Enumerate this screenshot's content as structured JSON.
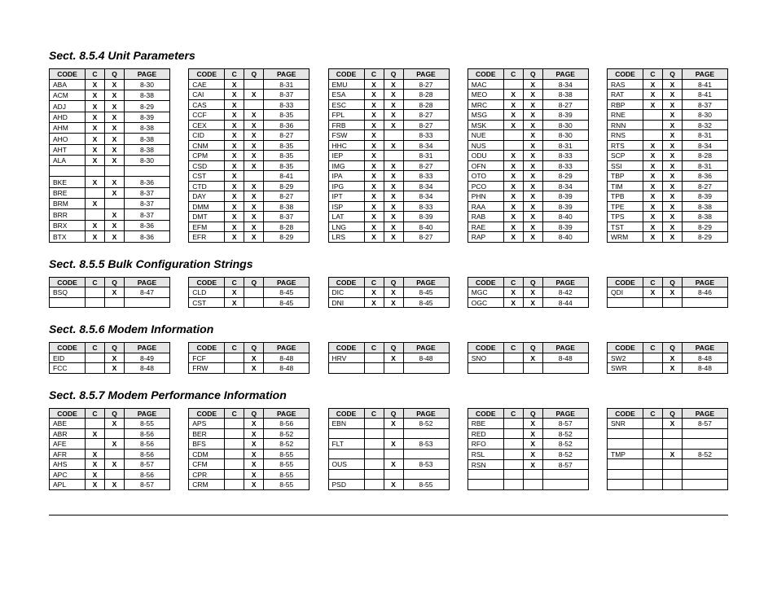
{
  "headers": {
    "code": "CODE",
    "c": "C",
    "q": "Q",
    "page": "PAGE"
  },
  "sections": [
    {
      "title": "Sect. 8.5.4 Unit Parameters",
      "tables": [
        [
          {
            "code": "ABA",
            "c": "X",
            "q": "X",
            "page": "8-30"
          },
          {
            "code": "ACM",
            "c": "X",
            "q": "X",
            "page": "8-38"
          },
          {
            "code": "ADJ",
            "c": "X",
            "q": "X",
            "page": "8-29"
          },
          {
            "code": "AHD",
            "c": "X",
            "q": "X",
            "page": "8-39"
          },
          {
            "code": "AHM",
            "c": "X",
            "q": "X",
            "page": "8-38"
          },
          {
            "code": "AHO",
            "c": "X",
            "q": "X",
            "page": "8-38"
          },
          {
            "code": "AHT",
            "c": "X",
            "q": "X",
            "page": "8-38"
          },
          {
            "code": "ALA",
            "c": "X",
            "q": "X",
            "page": "8-30"
          },
          {
            "code": "",
            "c": "",
            "q": "",
            "page": ""
          },
          {
            "code": "BKE",
            "c": "X",
            "q": "X",
            "page": "8-36"
          },
          {
            "code": "BRE",
            "c": "",
            "q": "X",
            "page": "8-37"
          },
          {
            "code": "BRM",
            "c": "X",
            "q": "",
            "page": "8-37"
          },
          {
            "code": "BRR",
            "c": "",
            "q": "X",
            "page": "8-37"
          },
          {
            "code": "BRX",
            "c": "X",
            "q": "X",
            "page": "8-36"
          },
          {
            "code": "BTX",
            "c": "X",
            "q": "X",
            "page": "8-36"
          }
        ],
        [
          {
            "code": "CAE",
            "c": "X",
            "q": "",
            "page": "8-31"
          },
          {
            "code": "CAI",
            "c": "X",
            "q": "X",
            "page": "8-37"
          },
          {
            "code": "CAS",
            "c": "X",
            "q": "",
            "page": "8-33"
          },
          {
            "code": "CCF",
            "c": "X",
            "q": "X",
            "page": "8-35"
          },
          {
            "code": "CEX",
            "c": "X",
            "q": "X",
            "page": "8-36"
          },
          {
            "code": "CID",
            "c": "X",
            "q": "X",
            "page": "8-27"
          },
          {
            "code": "CNM",
            "c": "X",
            "q": "X",
            "page": "8-35"
          },
          {
            "code": "CPM",
            "c": "X",
            "q": "X",
            "page": "8-35"
          },
          {
            "code": "CSD",
            "c": "X",
            "q": "X",
            "page": "8-35"
          },
          {
            "code": "CST",
            "c": "X",
            "q": "",
            "page": "8-41"
          },
          {
            "code": "CTD",
            "c": "X",
            "q": "X",
            "page": "8-29"
          },
          {
            "code": "DAY",
            "c": "X",
            "q": "X",
            "page": "8-27"
          },
          {
            "code": "DMM",
            "c": "X",
            "q": "X",
            "page": "8-38"
          },
          {
            "code": "DMT",
            "c": "X",
            "q": "X",
            "page": "8-37"
          },
          {
            "code": "EFM",
            "c": "X",
            "q": "X",
            "page": "8-28"
          },
          {
            "code": "EFR",
            "c": "X",
            "q": "X",
            "page": "8-29"
          }
        ],
        [
          {
            "code": "EMU",
            "c": "X",
            "q": "X",
            "page": "8-27"
          },
          {
            "code": "ESA",
            "c": "X",
            "q": "X",
            "page": "8-28"
          },
          {
            "code": "ESC",
            "c": "X",
            "q": "X",
            "page": "8-28"
          },
          {
            "code": "FPL",
            "c": "X",
            "q": "X",
            "page": "8-27"
          },
          {
            "code": "FRB",
            "c": "X",
            "q": "X",
            "page": "8-27"
          },
          {
            "code": "FSW",
            "c": "X",
            "q": "",
            "page": "8-33"
          },
          {
            "code": "HHC",
            "c": "X",
            "q": "X",
            "page": "8-34"
          },
          {
            "code": "IEP",
            "c": "X",
            "q": "",
            "page": "8-31"
          },
          {
            "code": "IMG",
            "c": "X",
            "q": "X",
            "page": "8-27"
          },
          {
            "code": "IPA",
            "c": "X",
            "q": "X",
            "page": "8-33"
          },
          {
            "code": "IPG",
            "c": "X",
            "q": "X",
            "page": "8-34"
          },
          {
            "code": "IPT",
            "c": "X",
            "q": "X",
            "page": "8-34"
          },
          {
            "code": "ISP",
            "c": "X",
            "q": "X",
            "page": "8-33"
          },
          {
            "code": "LAT",
            "c": "X",
            "q": "X",
            "page": "8-39"
          },
          {
            "code": "LNG",
            "c": "X",
            "q": "X",
            "page": "8-40"
          },
          {
            "code": "LRS",
            "c": "X",
            "q": "X",
            "page": "8-27"
          }
        ],
        [
          {
            "code": "MAC",
            "c": "",
            "q": "X",
            "page": "8-34"
          },
          {
            "code": "MEO",
            "c": "X",
            "q": "X",
            "page": "8-38"
          },
          {
            "code": "MRC",
            "c": "X",
            "q": "X",
            "page": "8-27"
          },
          {
            "code": "MSG",
            "c": "X",
            "q": "X",
            "page": "8-39"
          },
          {
            "code": "MSK",
            "c": "X",
            "q": "X",
            "page": "8-30"
          },
          {
            "code": "NUE",
            "c": "",
            "q": "X",
            "page": "8-30"
          },
          {
            "code": "NUS",
            "c": "",
            "q": "X",
            "page": "8-31"
          },
          {
            "code": "ODU",
            "c": "X",
            "q": "X",
            "page": "8-33"
          },
          {
            "code": "OFN",
            "c": "X",
            "q": "X",
            "page": "8-33"
          },
          {
            "code": "OTO",
            "c": "X",
            "q": "X",
            "page": "8-29"
          },
          {
            "code": "PCO",
            "c": "X",
            "q": "X",
            "page": "8-34"
          },
          {
            "code": "PHN",
            "c": "X",
            "q": "X",
            "page": "8-39"
          },
          {
            "code": "RAA",
            "c": "X",
            "q": "X",
            "page": "8-39"
          },
          {
            "code": "RAB",
            "c": "X",
            "q": "X",
            "page": "8-40"
          },
          {
            "code": "RAE",
            "c": "X",
            "q": "X",
            "page": "8-39"
          },
          {
            "code": "RAP",
            "c": "X",
            "q": "X",
            "page": "8-40"
          }
        ],
        [
          {
            "code": "RAS",
            "c": "X",
            "q": "X",
            "page": "8-41"
          },
          {
            "code": "RAT",
            "c": "X",
            "q": "X",
            "page": "8-41"
          },
          {
            "code": "RBP",
            "c": "X",
            "q": "X",
            "page": "8-37"
          },
          {
            "code": "RNE",
            "c": "",
            "q": "X",
            "page": "8-30"
          },
          {
            "code": "RNN",
            "c": "",
            "q": "X",
            "page": "8-32"
          },
          {
            "code": "RNS",
            "c": "",
            "q": "X",
            "page": "8-31"
          },
          {
            "code": "RTS",
            "c": "X",
            "q": "X",
            "page": "8-34"
          },
          {
            "code": "SCP",
            "c": "X",
            "q": "X",
            "page": "8-28"
          },
          {
            "code": "SSI",
            "c": "X",
            "q": "X",
            "page": "8-31"
          },
          {
            "code": "TBP",
            "c": "X",
            "q": "X",
            "page": "8-36"
          },
          {
            "code": "TIM",
            "c": "X",
            "q": "X",
            "page": "8-27"
          },
          {
            "code": "TPB",
            "c": "X",
            "q": "X",
            "page": "8-39"
          },
          {
            "code": "TPE",
            "c": "X",
            "q": "X",
            "page": "8-38"
          },
          {
            "code": "TPS",
            "c": "X",
            "q": "X",
            "page": "8-38"
          },
          {
            "code": "TST",
            "c": "X",
            "q": "X",
            "page": "8-29"
          },
          {
            "code": "WRM",
            "c": "X",
            "q": "X",
            "page": "8-29"
          }
        ]
      ]
    },
    {
      "title": "Sect. 8.5.5 Bulk Configuration Strings",
      "tables": [
        [
          {
            "code": "BSQ",
            "c": "",
            "q": "X",
            "page": "8-47"
          },
          {
            "code": "",
            "c": "",
            "q": "",
            "page": ""
          }
        ],
        [
          {
            "code": "CLD",
            "c": "X",
            "q": "",
            "page": "8-45"
          },
          {
            "code": "CST",
            "c": "X",
            "q": "",
            "page": "8-45"
          }
        ],
        [
          {
            "code": "DIC",
            "c": "X",
            "q": "X",
            "page": "8-45"
          },
          {
            "code": "DNI",
            "c": "X",
            "q": "X",
            "page": "8-45"
          }
        ],
        [
          {
            "code": "MGC",
            "c": "X",
            "q": "X",
            "page": "8-42"
          },
          {
            "code": "OGC",
            "c": "X",
            "q": "X",
            "page": "8-44"
          }
        ],
        [
          {
            "code": "QDI",
            "c": "X",
            "q": "X",
            "page": "8-46"
          },
          {
            "code": "",
            "c": "",
            "q": "",
            "page": ""
          }
        ]
      ]
    },
    {
      "title": "Sect. 8.5.6 Modem Information",
      "tables": [
        [
          {
            "code": "EID",
            "c": "",
            "q": "X",
            "page": "8-49"
          },
          {
            "code": "FCC",
            "c": "",
            "q": "X",
            "page": "8-48"
          }
        ],
        [
          {
            "code": "FCF",
            "c": "",
            "q": "X",
            "page": "8-48"
          },
          {
            "code": "FRW",
            "c": "",
            "q": "X",
            "page": "8-48"
          }
        ],
        [
          {
            "code": "HRV",
            "c": "",
            "q": "X",
            "page": "8-48"
          },
          {
            "code": "",
            "c": "",
            "q": "",
            "page": ""
          }
        ],
        [
          {
            "code": "SNO",
            "c": "",
            "q": "X",
            "page": "8-48"
          },
          {
            "code": "",
            "c": "",
            "q": "",
            "page": ""
          }
        ],
        [
          {
            "code": "SW2",
            "c": "",
            "q": "X",
            "page": "8-48"
          },
          {
            "code": "SWR",
            "c": "",
            "q": "X",
            "page": "8-48"
          }
        ]
      ]
    },
    {
      "title": "Sect. 8.5.7 Modem Performance Information",
      "tables": [
        [
          {
            "code": "ABE",
            "c": "",
            "q": "X",
            "page": "8-55"
          },
          {
            "code": "ABR",
            "c": "X",
            "q": "",
            "page": "8-56"
          },
          {
            "code": "AFE",
            "c": "",
            "q": "X",
            "page": "8-56"
          },
          {
            "code": "AFR",
            "c": "X",
            "q": "",
            "page": "8-56"
          },
          {
            "code": "AHS",
            "c": "X",
            "q": "X",
            "page": "8-57"
          },
          {
            "code": "APC",
            "c": "X",
            "q": "",
            "page": "8-56"
          },
          {
            "code": "APL",
            "c": "X",
            "q": "X",
            "page": "8-57"
          }
        ],
        [
          {
            "code": "APS",
            "c": "",
            "q": "X",
            "page": "8-56"
          },
          {
            "code": "BER",
            "c": "",
            "q": "X",
            "page": "8-52"
          },
          {
            "code": "BFS",
            "c": "",
            "q": "X",
            "page": "8-52"
          },
          {
            "code": "CDM",
            "c": "",
            "q": "X",
            "page": "8-55"
          },
          {
            "code": "CFM",
            "c": "",
            "q": "X",
            "page": "8-55"
          },
          {
            "code": "CPR",
            "c": "",
            "q": "X",
            "page": "8-55"
          },
          {
            "code": "CRM",
            "c": "",
            "q": "X",
            "page": "8-55"
          }
        ],
        [
          {
            "code": "EBN",
            "c": "",
            "q": "X",
            "page": "8-52"
          },
          {
            "code": "",
            "c": "",
            "q": "",
            "page": ""
          },
          {
            "code": "FLT",
            "c": "",
            "q": "X",
            "page": "8-53"
          },
          {
            "code": "",
            "c": "",
            "q": "",
            "page": ""
          },
          {
            "code": "OUS",
            "c": "",
            "q": "X",
            "page": "8-53"
          },
          {
            "code": "",
            "c": "",
            "q": "",
            "page": ""
          },
          {
            "code": "PSD",
            "c": "",
            "q": "X",
            "page": "8-55"
          }
        ],
        [
          {
            "code": "RBE",
            "c": "",
            "q": "X",
            "page": "8-57"
          },
          {
            "code": "RED",
            "c": "",
            "q": "X",
            "page": "8-52"
          },
          {
            "code": "RFO",
            "c": "",
            "q": "X",
            "page": "8-52"
          },
          {
            "code": "RSL",
            "c": "",
            "q": "X",
            "page": "8-52"
          },
          {
            "code": "RSN",
            "c": "",
            "q": "X",
            "page": "8-57"
          },
          {
            "code": "",
            "c": "",
            "q": "",
            "page": ""
          },
          {
            "code": "",
            "c": "",
            "q": "",
            "page": ""
          }
        ],
        [
          {
            "code": "SNR",
            "c": "",
            "q": "X",
            "page": "8-57"
          },
          {
            "code": "",
            "c": "",
            "q": "",
            "page": ""
          },
          {
            "code": "",
            "c": "",
            "q": "",
            "page": ""
          },
          {
            "code": "TMP",
            "c": "",
            "q": "X",
            "page": "8-52"
          },
          {
            "code": "",
            "c": "",
            "q": "",
            "page": ""
          },
          {
            "code": "",
            "c": "",
            "q": "",
            "page": ""
          },
          {
            "code": "",
            "c": "",
            "q": "",
            "page": ""
          }
        ]
      ]
    }
  ]
}
